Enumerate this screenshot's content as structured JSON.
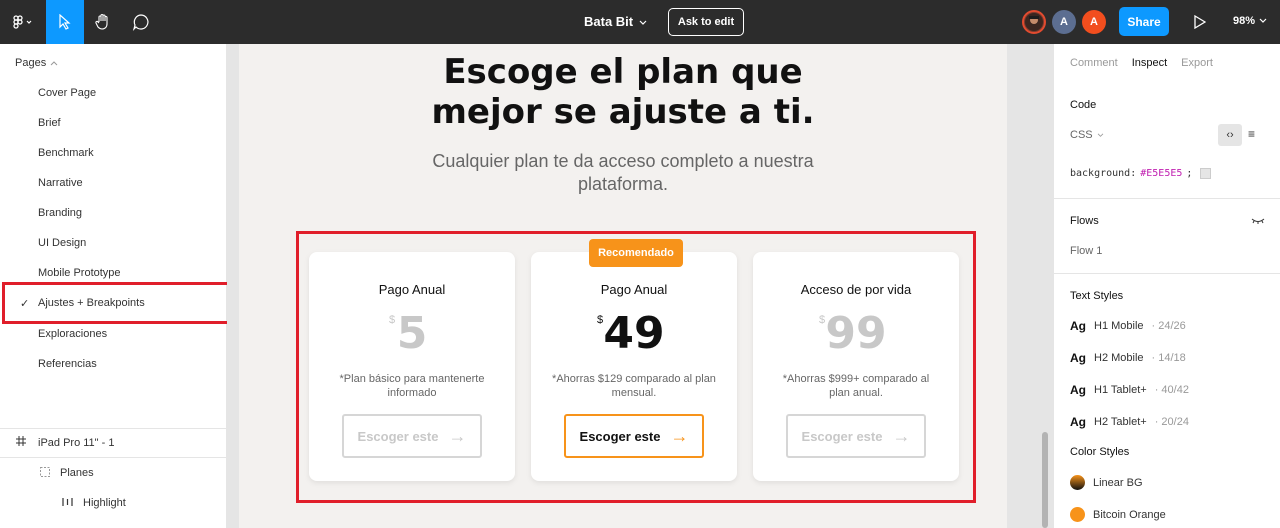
{
  "topbar": {
    "file_name": "Bata Bit",
    "ask_to_edit": "Ask to edit",
    "avatars": [
      "A",
      "A"
    ],
    "share": "Share",
    "zoom": "98%"
  },
  "left": {
    "pages_label": "Pages",
    "pages": [
      {
        "label": "Cover Page"
      },
      {
        "label": "Brief"
      },
      {
        "label": "Benchmark"
      },
      {
        "label": "Narrative"
      },
      {
        "label": "Branding"
      },
      {
        "label": "UI Design"
      },
      {
        "label": "Mobile Prototype"
      },
      {
        "label": "Ajustes + Breakpoints",
        "active": true
      },
      {
        "label": "Exploraciones"
      },
      {
        "label": "Referencias"
      }
    ],
    "layers": [
      {
        "label": "iPad Pro 11\" - 1"
      },
      {
        "label": "Planes"
      },
      {
        "label": "Highlight"
      }
    ]
  },
  "artboard": {
    "title_line1": "Escoge el plan que",
    "title_line2": "mejor se ajuste a ti.",
    "subtitle_line1": "Cualquier plan te da acceso completo a nuestra",
    "subtitle_line2": "plataforma.",
    "badge": "Recomendado",
    "cards": [
      {
        "title": "Pago Anual",
        "currency": "$",
        "price": "5",
        "desc_line1": "*Plan básico para mantenerte",
        "desc_line2": "informado",
        "button": "Escoger este",
        "active": false
      },
      {
        "title": "Pago Anual",
        "currency": "$",
        "price": "49",
        "desc_line1": "*Ahorras $129 comparado al plan",
        "desc_line2": "mensual.",
        "button": "Escoger este",
        "active": true
      },
      {
        "title": "Acceso de por vida",
        "currency": "$",
        "price": "99",
        "desc_line1": "*Ahorras $999+ comparado al",
        "desc_line2": "plan anual.",
        "button": "Escoger este",
        "active": false
      }
    ]
  },
  "right": {
    "tabs": [
      "Comment",
      "Inspect",
      "Export"
    ],
    "active_tab": "Inspect",
    "code_label": "Code",
    "code_lang": "CSS",
    "code_prop": "background:",
    "code_value": "#E5E5E5",
    "code_semicolon": ";",
    "flows_label": "Flows",
    "flow_item": "Flow 1",
    "text_styles_label": "Text Styles",
    "text_styles": [
      {
        "ag": "Ag",
        "name": "H1 Mobile",
        "meta": "· 24/26"
      },
      {
        "ag": "Ag",
        "name": "H2 Mobile",
        "meta": "· 14/18"
      },
      {
        "ag": "Ag",
        "name": "H1 Tablet+",
        "meta": "· 40/42"
      },
      {
        "ag": "Ag",
        "name": "H2 Tablet+",
        "meta": "· 20/24"
      }
    ],
    "color_styles_label": "Color Styles",
    "color_styles": [
      {
        "name": "Linear BG",
        "color": "#3a2a1a"
      },
      {
        "name": "Bitcoin Orange",
        "color": "#f7931a"
      }
    ]
  },
  "colors": {
    "accent_blue": "#0d99ff",
    "highlight_red": "#e01e2a",
    "brand_orange": "#f7931a"
  }
}
